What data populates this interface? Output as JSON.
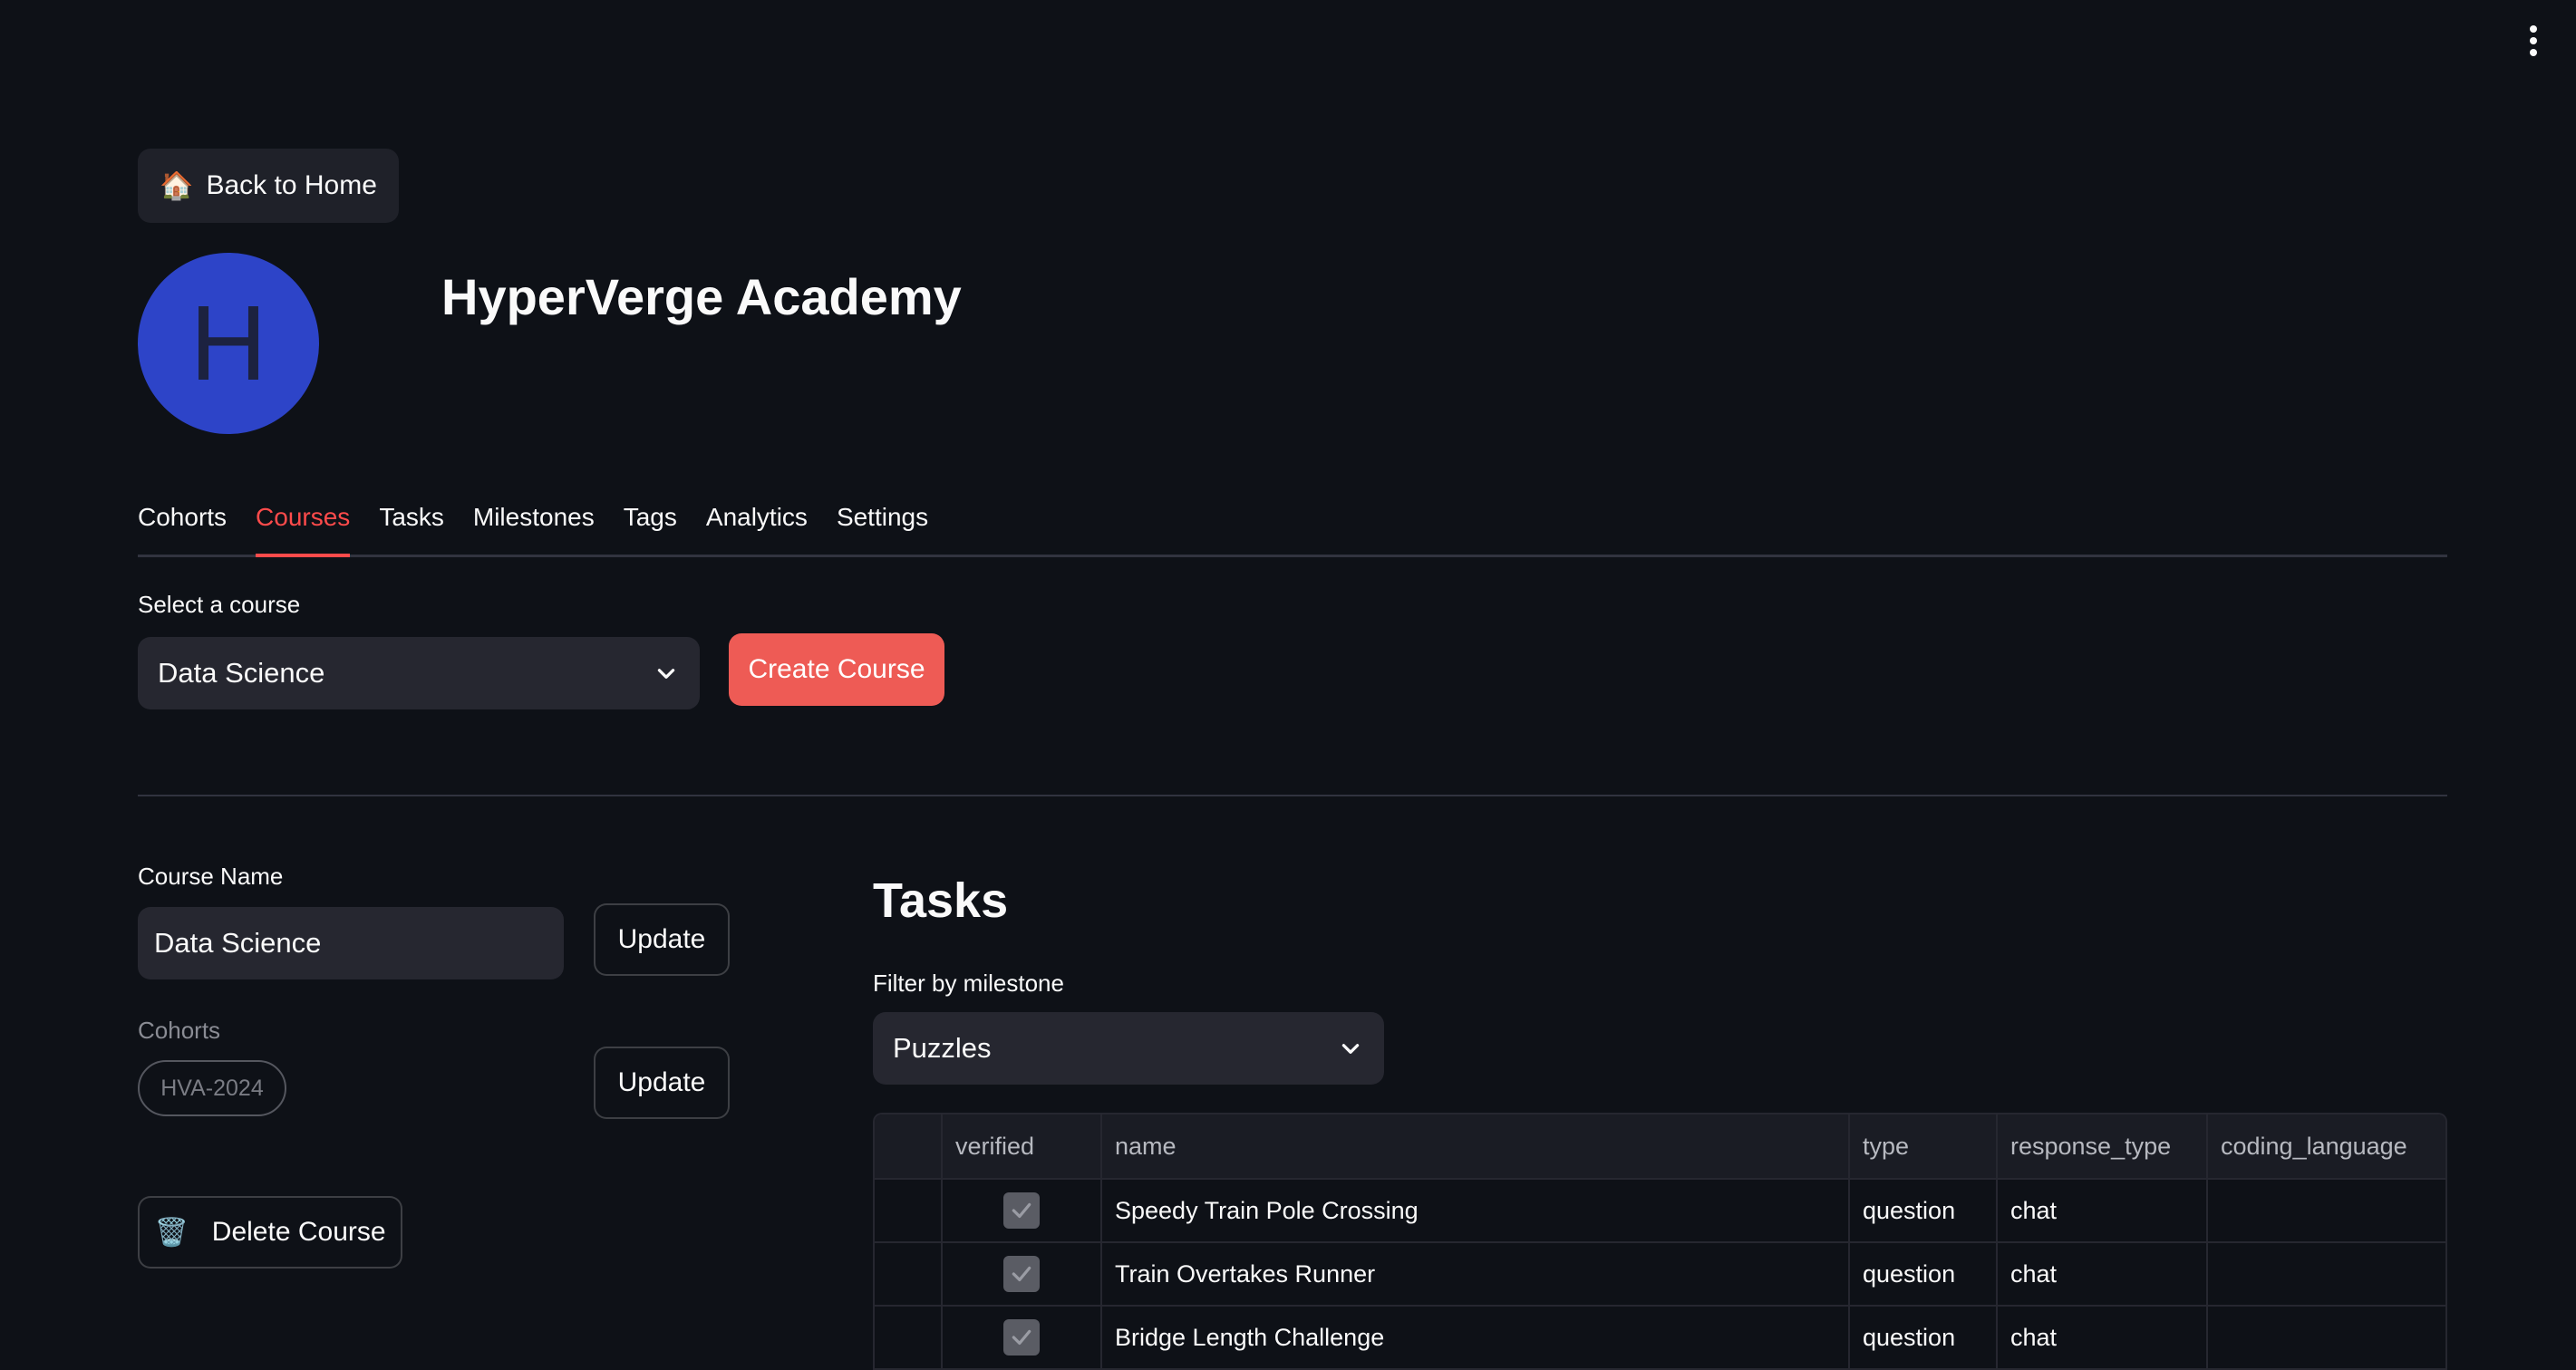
{
  "toolbar": {
    "menu_icon": "kebab-vertical-icon"
  },
  "header": {
    "back_button": {
      "icon": "🏠",
      "label": "Back to Home"
    },
    "avatar_letter": "H",
    "avatar_color": "#2d44c8",
    "org_name": "HyperVerge Academy"
  },
  "tabs": [
    {
      "label": "Cohorts",
      "active": false
    },
    {
      "label": "Courses",
      "active": true
    },
    {
      "label": "Tasks",
      "active": false
    },
    {
      "label": "Milestones",
      "active": false
    },
    {
      "label": "Tags",
      "active": false
    },
    {
      "label": "Analytics",
      "active": false
    },
    {
      "label": "Settings",
      "active": false
    }
  ],
  "course_select": {
    "label": "Select a course",
    "value": "Data Science",
    "create_label": "Create Course"
  },
  "course_form": {
    "name_label": "Course Name",
    "name_value": "Data Science",
    "update_label": "Update",
    "cohorts_label": "Cohorts",
    "cohort_chip": "HVA-2024",
    "cohorts_update_label": "Update",
    "delete_icon": "🗑️",
    "delete_label": "Delete Course"
  },
  "tasks": {
    "title": "Tasks",
    "filter_label": "Filter by milestone",
    "filter_value": "Puzzles",
    "columns": [
      "",
      "verified",
      "name",
      "type",
      "response_type",
      "coding_language"
    ],
    "rows": [
      {
        "verified": true,
        "name": "Speedy Train Pole Crossing",
        "type": "question",
        "response_type": "chat",
        "coding_language": ""
      },
      {
        "verified": true,
        "name": "Train Overtakes Runner",
        "type": "question",
        "response_type": "chat",
        "coding_language": ""
      },
      {
        "verified": true,
        "name": "Bridge Length Challenge",
        "type": "question",
        "response_type": "chat",
        "coding_language": ""
      }
    ]
  },
  "colors": {
    "background": "#0e1117",
    "accent": "#ff4b4b",
    "primary_button": "#ee5b55"
  }
}
